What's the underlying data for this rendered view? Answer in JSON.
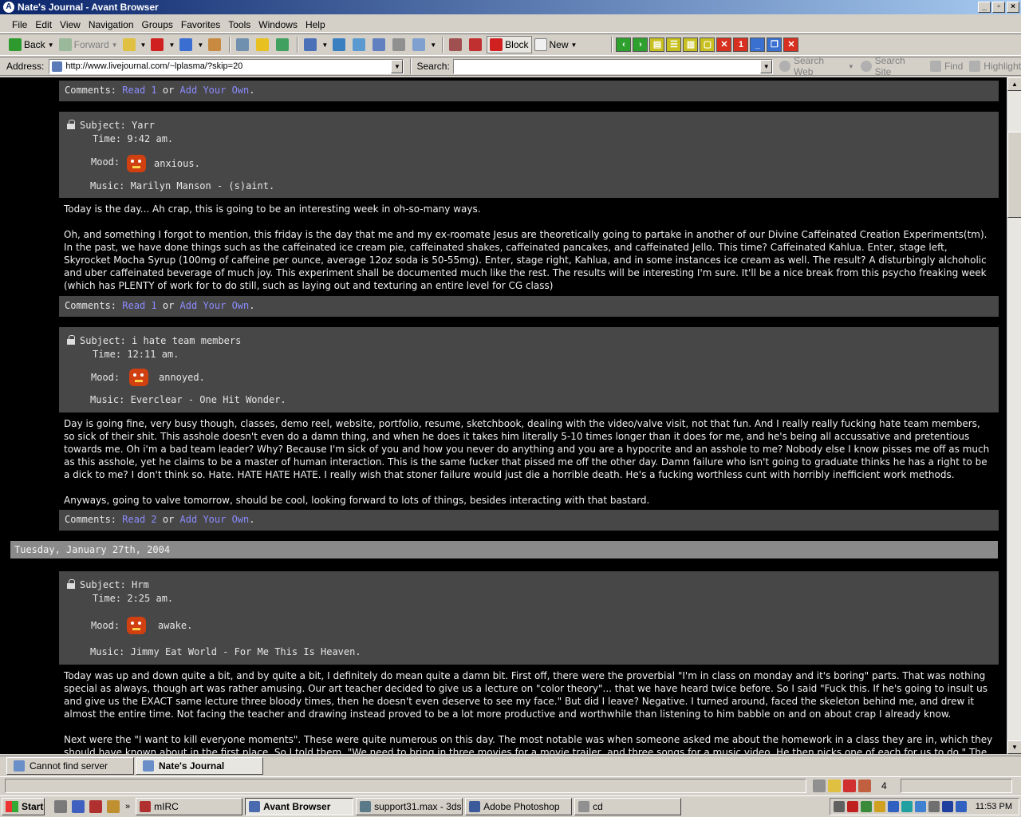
{
  "window": {
    "title": "Nate's Journal - Avant Browser"
  },
  "menu": [
    "File",
    "Edit",
    "View",
    "Navigation",
    "Groups",
    "Favorites",
    "Tools",
    "Windows",
    "Help"
  ],
  "toolbar": {
    "back": "Back",
    "forward": "Forward",
    "block": "Block",
    "new": "New",
    "close_badge": "1"
  },
  "address": {
    "label": "Address:",
    "url": "http://www.livejournal.com/~lplasma/?skip=20"
  },
  "search": {
    "label": "Search:",
    "value": "",
    "search_web": "Search Web",
    "search_site": "Search Site",
    "find": "Find",
    "highlight": "Highlight"
  },
  "journal": {
    "top_comments": {
      "prefix": "Comments:",
      "read": "Read 1",
      "or": "or",
      "add": "Add Your Own",
      "end": "."
    },
    "entries": [
      {
        "subject_label": "Subject:",
        "subject": "Yarr",
        "time_label": "Time:",
        "time": "9:42 am.",
        "mood_label": "Mood:",
        "mood": "anxious.",
        "music_label": "Music:",
        "music": "Marilyn Manson - (s)aint.",
        "paragraphs": [
          "Today is the day... Ah crap, this is going to be an interesting week in oh-so-many ways.",
          "Oh, and something I forgot to mention, this friday is the day that me and my ex-roomate Jesus are theoretically going to partake in another of our Divine Caffeinated Creation Experiments(tm). In the past, we have done things such as the caffeinated ice cream pie, caffeinated shakes, caffeinated pancakes, and caffeinated Jello. This time? Caffeinated Kahlua. Enter, stage left, Skyrocket Mocha Syrup (100mg of caffeine per ounce, average 12oz soda is 50-55mg). Enter, stage right, Kahlua, and in some instances ice cream as well. The result? A disturbingly alchoholic and uber caffeinated beverage of much joy. This experiment shall be documented much like the rest. The results will be interesting I'm sure. It'll be a nice break from this psycho freaking week (which has PLENTY of work for to do still, such as laying out and texturing an entire level for CG class)"
        ],
        "comments": {
          "prefix": "Comments:",
          "read": "Read 1",
          "or": "or",
          "add": "Add Your Own",
          "end": "."
        }
      },
      {
        "subject_label": "Subject:",
        "subject": "i hate team members",
        "time_label": "Time:",
        "time": "12:11 am.",
        "mood_label": "Mood:",
        "mood": "annoyed.",
        "music_label": "Music:",
        "music": "Everclear - One Hit Wonder.",
        "paragraphs": [
          "Day is going fine, very busy though, classes, demo reel, website, portfolio, resume, sketchbook, dealing with the video/valve visit, not that fun. And I really really fucking hate team members, so sick of their shit. This asshole doesn't even do a damn thing, and when he does it takes him literally 5-10 times longer than it does for me, and he's being all accussative and pretentious towards me. Oh i'm a bad team leader? Why? Because I'm sick of you and how you never do anything and you are a hypocrite and an asshole to me? Nobody else I know pisses me off as much as this asshole, yet he claims to be a master of human interaction. This is the same fucker that pissed me off the other day. Damn failure who isn't going to graduate thinks he has a right to be a dick to me? I don't think so. Hate. HATE HATE HATE. I really wish that stoner failure would just die a horrible death. He's a fucking worthless cunt with horribly inefficient work methods.",
          "Anyways, going to valve tomorrow, should be cool, looking forward to lots of things, besides interacting with that bastard."
        ],
        "comments": {
          "prefix": "Comments:",
          "read": "Read 2",
          "or": "or",
          "add": "Add Your Own",
          "end": "."
        }
      },
      {
        "date_header": "Tuesday, January 27th, 2004",
        "subject_label": "Subject:",
        "subject": "Hrm",
        "time_label": "Time:",
        "time": "2:25 am.",
        "mood_label": "Mood:",
        "mood": "awake.",
        "music_label": "Music:",
        "music": "Jimmy Eat World - For Me This Is Heaven.",
        "paragraphs": [
          "Today was up and down quite a bit, and by quite a bit, I definitely do mean quite a damn bit. First off, there were the proverbial \"I'm in class on monday and it's boring\" parts. That was nothing special as always, though art was rather amusing. Our art teacher decided to give us a lecture on \"color theory\"... that we have heard twice before. So I said \"Fuck this. If he's going to insult us and give us the EXACT same lecture three bloody times, then he doesn't even deserve to see my face.\" But did I leave? Negative. I turned around, faced the skeleton behind me, and drew it almost the entire time. Not facing the teacher and drawing instead proved to be a lot more productive and worthwhile than listening to him babble on and on about crap I already know.",
          "Next were the \"I want to kill everyone moments\". These were quite numerous on this day. The most notable was when someone asked me about the homework in a class they are in, which they should have known about in the first place. So I told them, \"We need to bring in three movies for a movie trailer, and three songs for a music video. He then picks one of each for us to do.\" The person then asks"
        ]
      }
    ]
  },
  "tabs": [
    {
      "label": "Cannot find server"
    },
    {
      "label": "Nate's Journal"
    }
  ],
  "status": {
    "count": "4"
  },
  "taskbar": {
    "start": "Start",
    "tasks": [
      {
        "label": "mIRC"
      },
      {
        "label": "Avant Browser"
      },
      {
        "label": "support31.max - 3ds..."
      },
      {
        "label": "Adobe Photoshop"
      },
      {
        "label": "cd"
      }
    ],
    "clock": "11:53 PM"
  },
  "colors": {
    "link": "#8c8cff",
    "entry_header_bg": "#474747",
    "date_band_bg": "#8a8a8a",
    "page_bg": "#000000"
  }
}
